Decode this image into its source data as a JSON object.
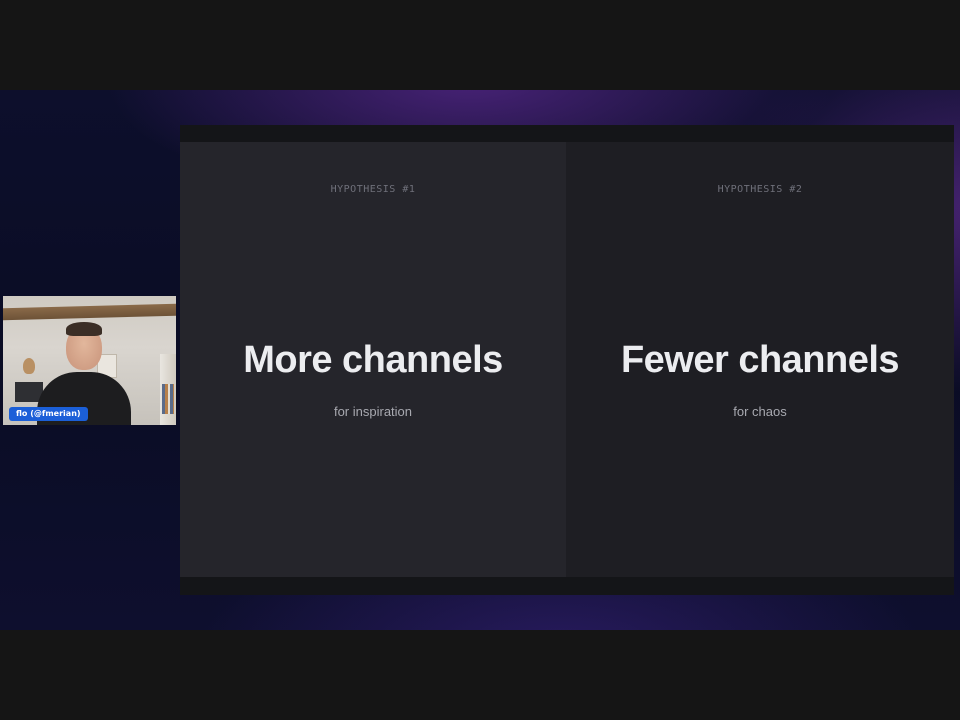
{
  "slide": {
    "left": {
      "eyebrow": "HYPOTHESIS #1",
      "headline": "More channels",
      "sub": "for inspiration"
    },
    "right": {
      "eyebrow": "HYPOTHESIS #2",
      "headline": "Fewer channels",
      "sub": "for chaos"
    }
  },
  "webcam": {
    "speaker_label": "flo (@fmerian)",
    "label_color": "#1b5fd8"
  },
  "colors": {
    "background_gradient": "#0d0f2c",
    "accent_purple": "#7832b4",
    "panel_left": "#25252b",
    "panel_right": "#1e1e23",
    "headline_text": "#ecedf0"
  }
}
